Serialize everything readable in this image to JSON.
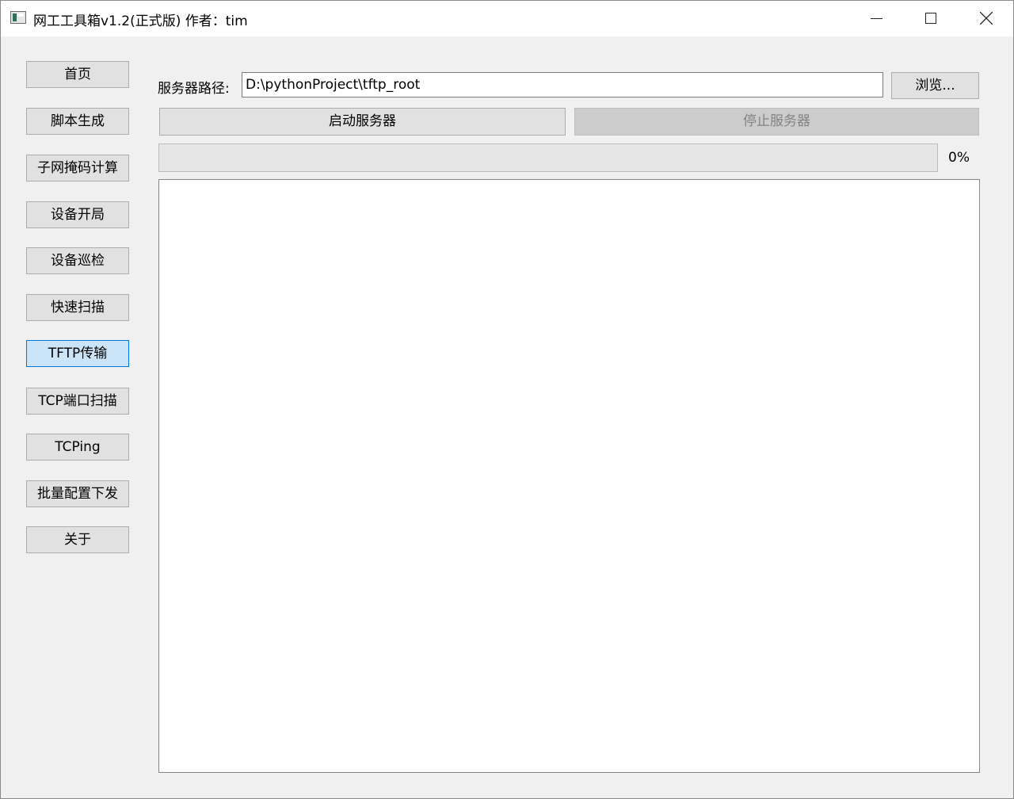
{
  "window": {
    "title": "网工工具箱v1.2(正式版) 作者：tim"
  },
  "sidebar": {
    "items": [
      {
        "label": "首页"
      },
      {
        "label": "脚本生成"
      },
      {
        "label": "子网掩码计算"
      },
      {
        "label": "设备开局"
      },
      {
        "label": "设备巡检"
      },
      {
        "label": "快速扫描"
      },
      {
        "label": "TFTP传输",
        "active": true
      },
      {
        "label": "TCP端口扫描"
      },
      {
        "label": "TCPing"
      },
      {
        "label": "批量配置下发"
      },
      {
        "label": "关于"
      }
    ]
  },
  "tftp": {
    "path_label": "服务器路径:",
    "path_value": "D:\\pythonProject\\tftp_root",
    "browse_label": "浏览...",
    "start_label": "启动服务器",
    "stop_label": "停止服务器",
    "progress_value": 0,
    "progress_text": "0%",
    "log_text": ""
  },
  "colors": {
    "active_bg": "#cce4f7",
    "active_border": "#0078d7",
    "progress_fill": "#06b025"
  }
}
